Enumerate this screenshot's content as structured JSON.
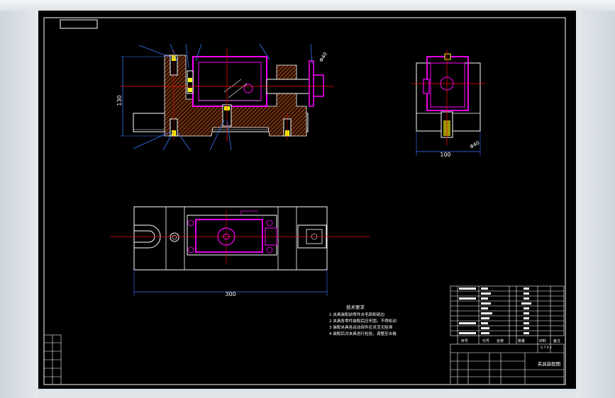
{
  "drawing": {
    "dimensions": {
      "front_height": "130",
      "front_top_right": "Φ40",
      "side_width": "100",
      "side_bottom_right": "Φ40",
      "top_width": "300"
    },
    "technical_requirements": {
      "heading": "技术要求",
      "items": [
        "1 夹具装配前零件去毛刺和锐边",
        "2 夹具各零件装配后应牢固，不得松动",
        "3 装配夹具各运动部件应灵活无阻滞",
        "4 装配后对夹具进行检验，调整至合格"
      ]
    },
    "title_block": {
      "drawing_title": "夹具装配图",
      "scale_code": "S.7.4.1",
      "header_labels": [
        "序号",
        "代号",
        "名称",
        "数量",
        "材料",
        "备注"
      ]
    }
  },
  "colors": {
    "background": "#000000",
    "white": "#ffffff",
    "magenta": "#ff00ff",
    "orange": "#c85a14",
    "red": "#ff0000",
    "blue": "#3a78ff",
    "yellow": "#ffff00"
  }
}
